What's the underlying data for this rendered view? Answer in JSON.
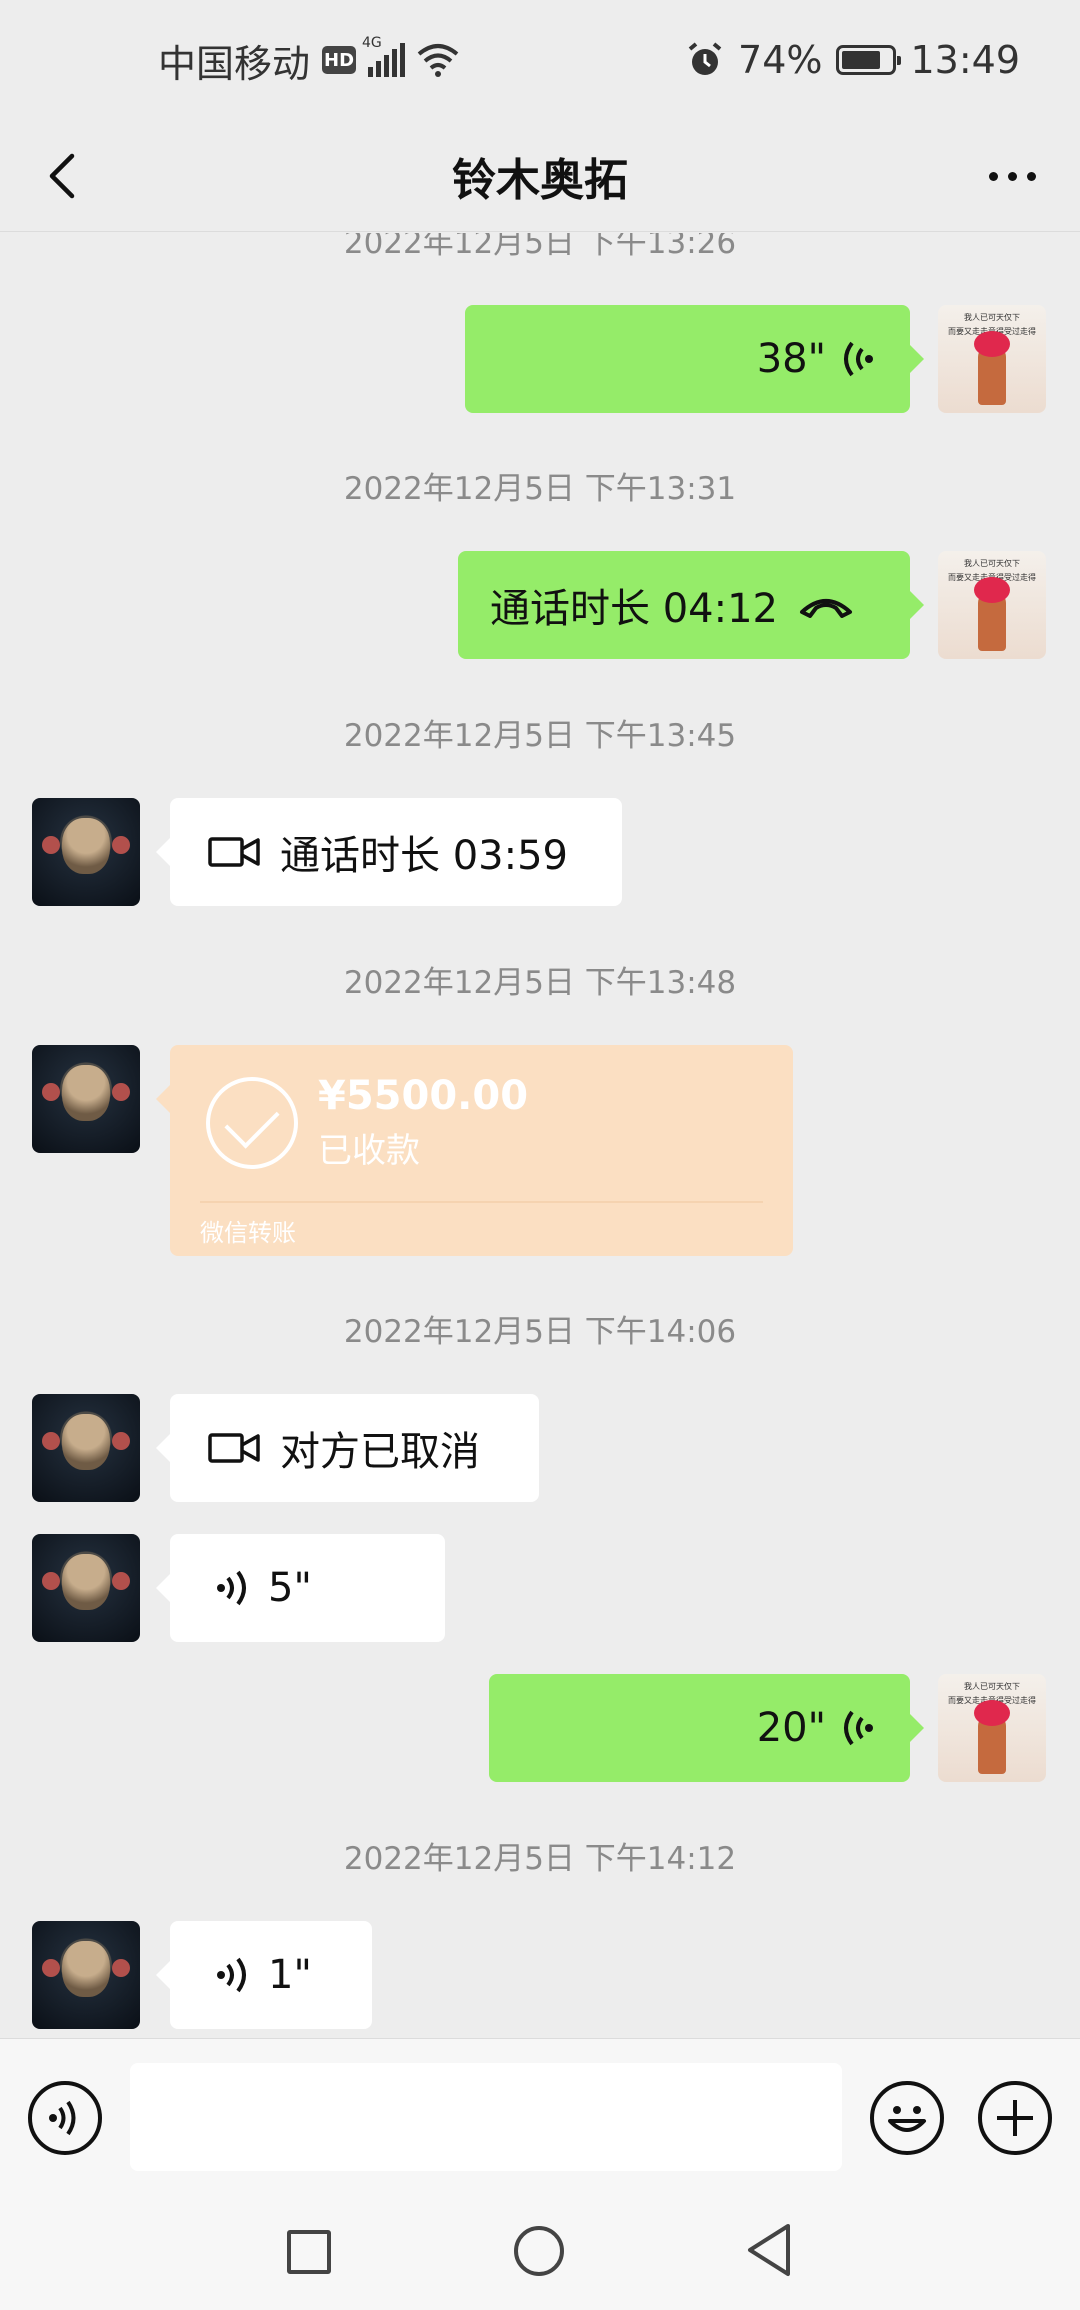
{
  "status_bar": {
    "carrier": "中国移动",
    "hd": "HD",
    "network": "4G",
    "battery": "74%",
    "time": "13:49"
  },
  "nav": {
    "title": "铃木奥拓"
  },
  "me_avatar_text": "我人已可天仅下\n而要又走走意得受过走得",
  "messages": {
    "ts0": "2022年12月5日 下午13:26",
    "voice_me_1": "38\"",
    "ts1": "2022年12月5日 下午13:31",
    "call_me": "通话时长 04:12",
    "ts2": "2022年12月5日 下午13:45",
    "video_friend_1": "通话时长 03:59",
    "ts3": "2022年12月5日 下午13:48",
    "transfer_amount": "¥5500.00",
    "transfer_status": "已收款",
    "transfer_footer": "微信转账",
    "ts4": "2022年12月5日 下午14:06",
    "video_friend_2": "对方已取消",
    "voice_friend_1": "5\"",
    "voice_me_2": "20\"",
    "ts5": "2022年12月5日 下午14:12",
    "voice_friend_2": "1\""
  },
  "colors": {
    "chat_bg": "#ededed",
    "bubble_me": "#95ec69",
    "bubble_friend": "#ffffff",
    "transfer_bg": "#fbdfc2"
  }
}
